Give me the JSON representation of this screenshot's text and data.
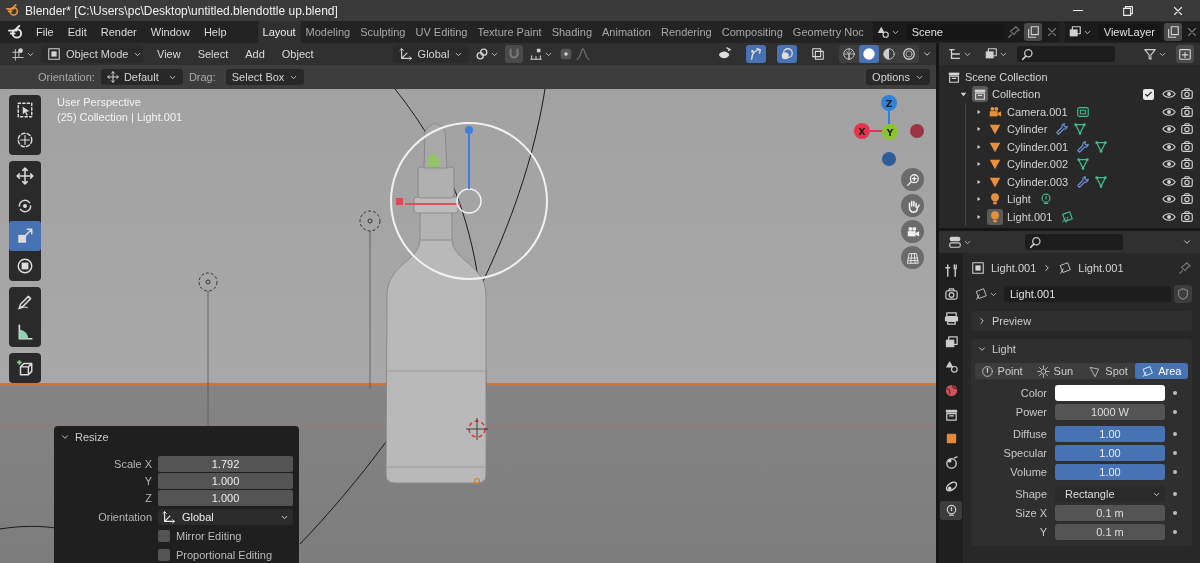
{
  "window": {
    "title": "Blender* [C:\\Users\\pc\\Desktop\\untitled.blendottle up.blend]"
  },
  "menu": [
    "File",
    "Edit",
    "Render",
    "Window",
    "Help"
  ],
  "workspaces": [
    {
      "label": "Layout",
      "selected": true
    },
    {
      "label": "Modeling",
      "selected": false
    },
    {
      "label": "Sculpting",
      "selected": false
    },
    {
      "label": "UV Editing",
      "selected": false
    },
    {
      "label": "Texture Paint",
      "selected": false
    },
    {
      "label": "Shading",
      "selected": false
    },
    {
      "label": "Animation",
      "selected": false
    },
    {
      "label": "Rendering",
      "selected": false
    },
    {
      "label": "Compositing",
      "selected": false
    },
    {
      "label": "Geometry Noc",
      "selected": false
    }
  ],
  "scene": "Scene",
  "view_layer": "ViewLayer",
  "viewport_header": {
    "mode": "Object Mode",
    "menus": [
      "View",
      "Select",
      "Add",
      "Object"
    ],
    "orientation": "Global",
    "toggles": [
      {
        "kind": "visibility",
        "on": false
      },
      {
        "kind": "gizmo",
        "on": true
      },
      {
        "kind": "overlay",
        "on": true
      },
      {
        "kind": "xray",
        "on": false
      }
    ],
    "shading": [
      {
        "kind": "wireframe",
        "selected": false
      },
      {
        "kind": "solid",
        "selected": true
      },
      {
        "kind": "material",
        "selected": false
      },
      {
        "kind": "rendered",
        "selected": false
      }
    ]
  },
  "tool_settings": {
    "orientation_label": "Orientation:",
    "orientation": "Default",
    "drag_label": "Drag:",
    "drag": "Select Box",
    "options": "Options"
  },
  "viewport": {
    "perspective": "User Perspective",
    "context": "(25) Collection | Light.001",
    "axes": [
      "Z",
      "X",
      "Y"
    ],
    "tools": [
      [
        {
          "kind": "select_box",
          "selected": false
        },
        {
          "kind": "cursor",
          "selected": false
        }
      ],
      [
        {
          "kind": "move",
          "selected": false
        },
        {
          "kind": "rotate",
          "selected": false
        },
        {
          "kind": "scale",
          "selected": true
        },
        {
          "kind": "transform",
          "selected": false
        }
      ],
      [
        {
          "kind": "annotate",
          "selected": false
        },
        {
          "kind": "measure",
          "selected": false
        }
      ],
      [
        {
          "kind": "add_cube",
          "selected": false
        }
      ]
    ]
  },
  "resize_panel": {
    "title": "Resize",
    "fields": [
      {
        "label": "Scale X",
        "value": "1.792"
      },
      {
        "label": "Y",
        "value": "1.000"
      },
      {
        "label": "Z",
        "value": "1.000"
      }
    ],
    "orientation_label": "Orientation",
    "orientation": "Global",
    "options": [
      {
        "label": "Mirror Editing",
        "checked": false
      },
      {
        "label": "Proportional Editing",
        "checked": false
      }
    ]
  },
  "outliner": {
    "root": "Scene Collection",
    "collection": {
      "label": "Collection",
      "checked": true,
      "expanded": true,
      "active": true,
      "children": [
        {
          "label": "Camera.001",
          "kind": "camera",
          "selected": false,
          "data": [
            {
              "kind": "camera_data"
            }
          ]
        },
        {
          "label": "Cylinder",
          "kind": "mesh",
          "selected": false,
          "data": [
            {
              "kind": "wrench"
            },
            {
              "kind": "mesh_data"
            }
          ]
        },
        {
          "label": "Cylinder.001",
          "kind": "mesh",
          "selected": false,
          "data": [
            {
              "kind": "wrench"
            },
            {
              "kind": "mesh_data"
            }
          ]
        },
        {
          "label": "Cylinder.002",
          "kind": "mesh",
          "selected": false,
          "data": [
            {
              "kind": "mesh_data"
            }
          ]
        },
        {
          "label": "Cylinder.003",
          "kind": "mesh",
          "selected": false,
          "data": [
            {
              "kind": "wrench"
            },
            {
              "kind": "mesh_data"
            }
          ]
        },
        {
          "label": "Light",
          "kind": "light",
          "selected": false,
          "data": [
            {
              "kind": "light_data"
            }
          ]
        },
        {
          "label": "Light.001",
          "kind": "light",
          "selected": true,
          "data": [
            {
              "kind": "area_data"
            }
          ]
        }
      ]
    }
  },
  "properties": {
    "tabs": [
      {
        "kind": "tool",
        "selected": false
      },
      {
        "kind": "render",
        "selected": false
      },
      {
        "kind": "output",
        "selected": false
      },
      {
        "kind": "view_layer",
        "selected": false
      },
      {
        "kind": "scene",
        "selected": false
      },
      {
        "kind": "world",
        "selected": false
      },
      {
        "kind": "collection",
        "selected": false
      },
      {
        "kind": "object",
        "selected": false
      },
      {
        "kind": "physics",
        "selected": false
      },
      {
        "kind": "constraints",
        "selected": false
      },
      {
        "kind": "data",
        "selected": true
      }
    ],
    "breadcrumb": [
      "Light.001",
      "Light.001"
    ],
    "datablock": "Light.001",
    "panels": [
      {
        "title": "Preview",
        "expanded": false
      },
      {
        "title": "Light",
        "expanded": true
      }
    ],
    "light_types": [
      {
        "kind": "point",
        "label": "Point",
        "selected": false
      },
      {
        "kind": "sun",
        "label": "Sun",
        "selected": false
      },
      {
        "kind": "spot",
        "label": "Spot",
        "selected": false
      },
      {
        "kind": "area",
        "label": "Area",
        "selected": true
      }
    ],
    "groups": [
      [
        {
          "label": "Color",
          "kind": "color",
          "color": "#ffffff"
        },
        {
          "label": "Power",
          "kind": "number",
          "value": "1000 W"
        }
      ],
      [
        {
          "label": "Diffuse",
          "kind": "slider",
          "value": "1.00",
          "level": 1
        },
        {
          "label": "Specular",
          "kind": "slider",
          "value": "1.00",
          "level": 1
        },
        {
          "label": "Volume",
          "kind": "slider",
          "value": "1.00",
          "level": 1
        }
      ],
      [
        {
          "label": "Shape",
          "kind": "dropdown",
          "value": "Rectangle"
        },
        {
          "label": "Size X",
          "kind": "number",
          "value": "0.1 m"
        },
        {
          "label": "Y",
          "kind": "number",
          "value": "0.1 m"
        }
      ]
    ]
  }
}
